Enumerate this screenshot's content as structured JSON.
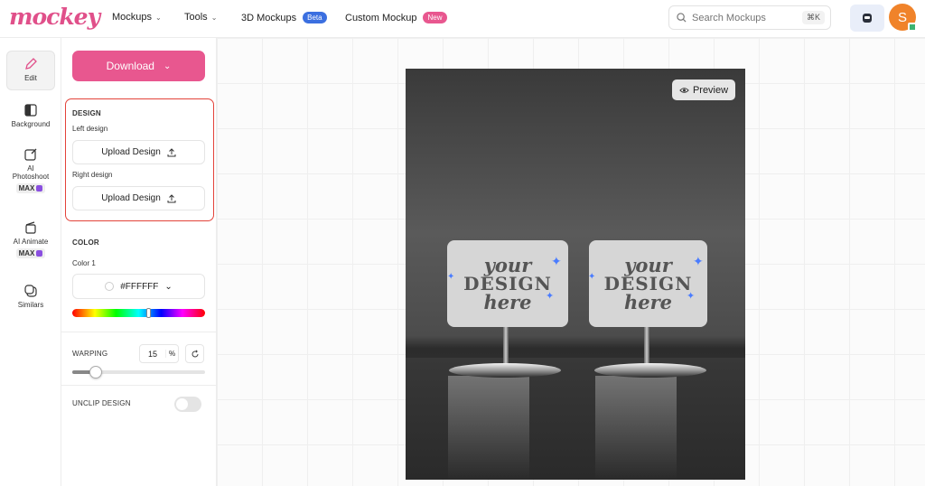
{
  "brand": {
    "logo_text": "mockey",
    "logo_color": "#e0508a"
  },
  "nav": {
    "mockups": "Mockups",
    "tools": "Tools",
    "mockups3d": "3D Mockups",
    "beta_badge": "Beta",
    "custom_mockup": "Custom Mockup",
    "new_badge": "New"
  },
  "search": {
    "placeholder": "Search Mockups",
    "shortcut": "⌘K"
  },
  "user": {
    "avatar_letter": "S"
  },
  "rail": {
    "edit": "Edit",
    "background": "Background",
    "ai_photoshoot_1": "AI",
    "ai_photoshoot_2": "Photoshoot",
    "ai_photoshoot_badge": "MAX",
    "ai_animate": "AI Animate",
    "ai_animate_badge": "MAX",
    "similars": "Similars"
  },
  "panel": {
    "download_label": "Download",
    "design_section": "DESIGN",
    "left_design_label": "Left design",
    "right_design_label": "Right design",
    "upload_label": "Upload Design",
    "color_section": "COLOR",
    "color1_label": "Color 1",
    "color1_value": "#FFFFFF",
    "hue_position": 0.57,
    "warping_label": "WARPING",
    "warping_value": "15",
    "warping_unit": "%",
    "warping_level": 0.15,
    "unclip_label": "UNCLIP DESIGN",
    "unclip_on": false
  },
  "canvas": {
    "preview_label": "Preview",
    "sign_text_line1": "your",
    "sign_text_line2": "DESIGN",
    "sign_text_line3": "here"
  },
  "colors": {
    "accent": "#e8578f",
    "highlight_box": "#e3433a",
    "beta": "#3b6fe0",
    "new": "#e8578f"
  }
}
